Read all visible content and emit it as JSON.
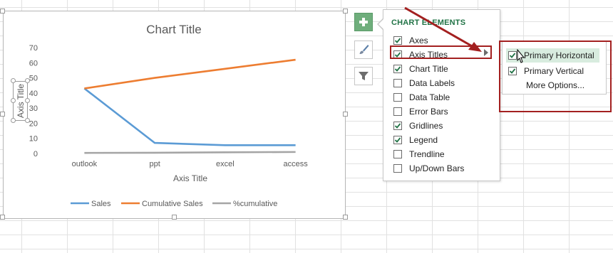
{
  "chart": {
    "title": "Chart Title",
    "x_axis_title": "Axis Title",
    "y_axis_title": "Axis Title"
  },
  "chart_data": {
    "type": "line",
    "title": "Chart Title",
    "xlabel": "Axis Title",
    "ylabel": "Axis Title",
    "categories": [
      "outlook",
      "ppt",
      "excel",
      "access"
    ],
    "ylim": [
      0,
      70
    ],
    "yticks": [
      0,
      10,
      20,
      30,
      40,
      50,
      60,
      70
    ],
    "grid": false,
    "legend_position": "bottom",
    "series": [
      {
        "name": "Sales",
        "values": [
          43,
          7,
          5.5,
          5.5
        ],
        "color": "#5b9bd5"
      },
      {
        "name": "Cumulative Sales",
        "values": [
          43,
          50,
          56,
          62
        ],
        "color": "#ed7d31"
      },
      {
        "name": "%cumulative",
        "values": [
          0.4,
          0.5,
          0.8,
          1
        ],
        "color": "#a5a5a5"
      }
    ]
  },
  "panel": {
    "title": "CHART ELEMENTS",
    "items": [
      {
        "label": "Axes",
        "checked": true
      },
      {
        "label": "Axis Titles",
        "checked": true
      },
      {
        "label": "Chart Title",
        "checked": true
      },
      {
        "label": "Data Labels",
        "checked": false
      },
      {
        "label": "Data Table",
        "checked": false
      },
      {
        "label": "Error Bars",
        "checked": false
      },
      {
        "label": "Gridlines",
        "checked": true
      },
      {
        "label": "Legend",
        "checked": true
      },
      {
        "label": "Trendline",
        "checked": false
      },
      {
        "label": "Up/Down Bars",
        "checked": false
      }
    ]
  },
  "submenu": {
    "items": [
      {
        "label": "Primary Horizontal",
        "checked": true
      },
      {
        "label": "Primary Vertical",
        "checked": true
      },
      {
        "label": "More Options...",
        "checked": null
      }
    ]
  },
  "colors": {
    "accent_green": "#217346",
    "annotation_red": "#a32020"
  }
}
